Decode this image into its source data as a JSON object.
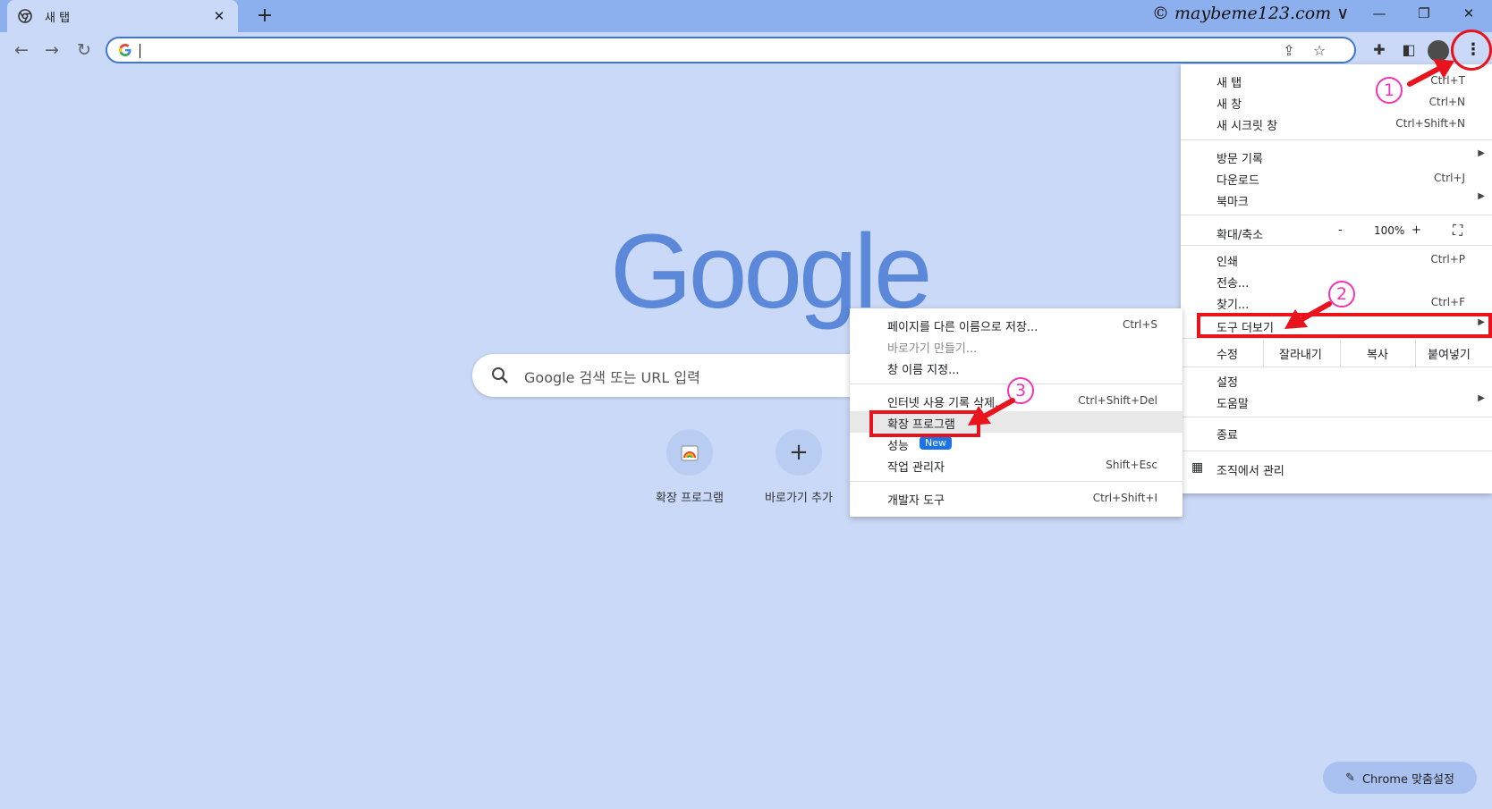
{
  "tab": {
    "title": "새 탭",
    "close_glyph": "✕",
    "new_tab_glyph": "+"
  },
  "watermark": "© maybeme123.com ∨",
  "window_controls": {
    "minimize": "—",
    "restore": "❐",
    "close": "✕"
  },
  "toolbar": {
    "back": "←",
    "forward": "→",
    "reload": "↻",
    "menu": "⋮"
  },
  "ntp": {
    "logo": "Google",
    "search_placeholder": "Google 검색 또는 URL 입력",
    "shortcuts": [
      {
        "label": "확장 프로그램"
      },
      {
        "label": "바로가기 추가",
        "glyph": "+"
      }
    ],
    "customize_label": "Chrome 맞춤설정"
  },
  "main_menu": {
    "items": [
      {
        "label": "새 탭",
        "shortcut": "Ctrl+T"
      },
      {
        "label": "새 창",
        "shortcut": "Ctrl+N"
      },
      {
        "label": "새 시크릿 창",
        "shortcut": "Ctrl+Shift+N"
      },
      {
        "label": "방문 기록",
        "shortcut": ""
      },
      {
        "label": "다운로드",
        "shortcut": "Ctrl+J"
      },
      {
        "label": "북마크",
        "shortcut": ""
      },
      {
        "label": "인쇄",
        "shortcut": "Ctrl+P"
      },
      {
        "label": "전송...",
        "shortcut": ""
      },
      {
        "label": "찾기...",
        "shortcut": "Ctrl+F"
      },
      {
        "label": "도구 더보기",
        "shortcut": ""
      },
      {
        "label": "설정",
        "shortcut": ""
      },
      {
        "label": "도움말",
        "shortcut": ""
      },
      {
        "label": "종료",
        "shortcut": ""
      },
      {
        "label": "조직에서 관리",
        "shortcut": ""
      }
    ],
    "zoom": {
      "label": "확대/축소",
      "minus": "-",
      "value": "100%",
      "plus": "+"
    },
    "edit": {
      "label": "수정",
      "cut": "잘라내기",
      "copy": "복사",
      "paste": "붙여넣기"
    }
  },
  "sub_menu": {
    "items": [
      {
        "label": "페이지를 다른 이름으로 저장...",
        "shortcut": "Ctrl+S"
      },
      {
        "label": "바로가기 만들기...",
        "shortcut": ""
      },
      {
        "label": "창 이름 지정...",
        "shortcut": ""
      },
      {
        "label": "인터넷 사용 기록 삭제...",
        "shortcut": "Ctrl+Shift+Del"
      },
      {
        "label": "확장 프로그램",
        "shortcut": ""
      },
      {
        "label": "성능",
        "shortcut": ""
      },
      {
        "label": "작업 관리자",
        "shortcut": "Shift+Esc"
      },
      {
        "label": "개발자 도구",
        "shortcut": "Ctrl+Shift+I"
      }
    ],
    "new_badge": "New"
  },
  "annotations": {
    "step1": "1",
    "step2": "2",
    "step3": "3"
  },
  "colors": {
    "accent_red": "#e8131d",
    "annotation_pink": "#f234b5",
    "google_blue": "#5b88d9"
  }
}
